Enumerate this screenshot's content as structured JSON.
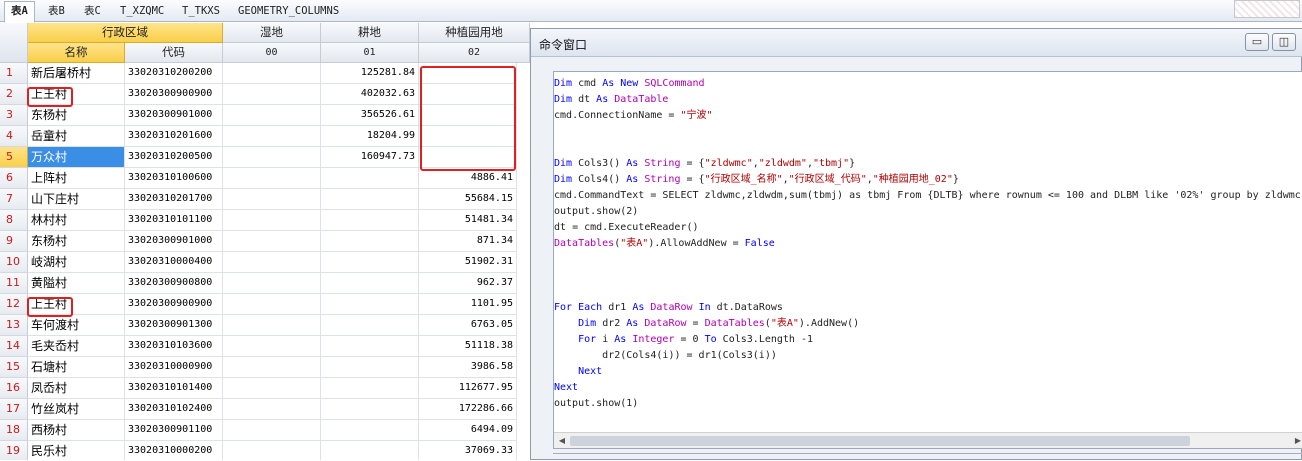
{
  "tabs": [
    "表A",
    "表B",
    "表C",
    "T_XZQMC",
    "T_TKXS",
    "GEOMETRY_COLUMNS"
  ],
  "grid": {
    "group_header": "行政区域",
    "headers": {
      "name": "名称",
      "code": "代码",
      "wet": "湿地",
      "wet_code": "00",
      "arable": "耕地",
      "arable_code": "01",
      "garden": "种植园用地",
      "garden_code": "02"
    },
    "rows": [
      {
        "n": "1",
        "name": "新后屠桥村",
        "code": "33020310200200",
        "arable": "125281.84",
        "garden": ""
      },
      {
        "n": "2",
        "name": "上王村",
        "code": "33020300900900",
        "arable": "402032.63",
        "garden": ""
      },
      {
        "n": "3",
        "name": "东杨村",
        "code": "33020300901000",
        "arable": "356526.61",
        "garden": ""
      },
      {
        "n": "4",
        "name": "岳童村",
        "code": "33020310201600",
        "arable": "18204.99",
        "garden": ""
      },
      {
        "n": "5",
        "name": "万众村",
        "code": "33020310200500",
        "arable": "160947.73",
        "garden": ""
      },
      {
        "n": "6",
        "name": "上阵村",
        "code": "33020310100600",
        "arable": "",
        "garden": "4886.41"
      },
      {
        "n": "7",
        "name": "山下庄村",
        "code": "33020310201700",
        "arable": "",
        "garden": "55684.15"
      },
      {
        "n": "8",
        "name": "林村村",
        "code": "33020310101100",
        "arable": "",
        "garden": "51481.34"
      },
      {
        "n": "9",
        "name": "东杨村",
        "code": "33020300901000",
        "arable": "",
        "garden": "871.34"
      },
      {
        "n": "10",
        "name": "岐湖村",
        "code": "33020310000400",
        "arable": "",
        "garden": "51902.31"
      },
      {
        "n": "11",
        "name": "黄隘村",
        "code": "33020300900800",
        "arable": "",
        "garden": "962.37"
      },
      {
        "n": "12",
        "name": "上王村",
        "code": "33020300900900",
        "arable": "",
        "garden": "1101.95"
      },
      {
        "n": "13",
        "name": "车何渡村",
        "code": "33020300901300",
        "arable": "",
        "garden": "6763.05"
      },
      {
        "n": "14",
        "name": "毛夹岙村",
        "code": "33020310103600",
        "arable": "",
        "garden": "51118.38"
      },
      {
        "n": "15",
        "name": "石塘村",
        "code": "33020310000900",
        "arable": "",
        "garden": "3986.58"
      },
      {
        "n": "16",
        "name": "凤岙村",
        "code": "33020310101400",
        "arable": "",
        "garden": "112677.95"
      },
      {
        "n": "17",
        "name": "竹丝岚村",
        "code": "33020310102400",
        "arable": "",
        "garden": "172286.66"
      },
      {
        "n": "18",
        "name": "西杨村",
        "code": "33020300901100",
        "arable": "",
        "garden": "6494.09"
      },
      {
        "n": "19",
        "name": "民乐村",
        "code": "33020310000200",
        "arable": "",
        "garden": "37069.33"
      }
    ]
  },
  "command_window": {
    "title": "命令窗口",
    "code_lines": [
      "Dim cmd As New SQLCommand",
      "Dim dt As DataTable",
      "cmd.ConnectionName = \"宁波\"",
      "",
      "",
      "Dim Cols3() As String = {\"zldwmc\",\"zldwdm\",\"tbmj\"}",
      "Dim Cols4() As String = {\"行政区域_名称\",\"行政区域_代码\",\"种植园用地_02\"}",
      "cmd.CommandText = \"SELECT zldwmc,zldwdm,sum(tbmj) as tbmj From {DLTB} where rownum <= 100 and DLBM like '02%' group by zldwmc,",
      "output.show(2)",
      "dt = cmd.ExecuteReader()",
      "DataTables(\"表A\").AllowAddNew = False",
      "",
      "",
      "",
      "For Each dr1 As DataRow In dt.DataRows",
      "    Dim dr2 As DataRow = DataTables(\"表A\").AddNew()",
      "    For i As Integer = 0 To Cols3.Length -1",
      "        dr2(Cols4(i)) = dr1(Cols3(i))",
      "    Next",
      "Next",
      "output.show(1)"
    ]
  }
}
